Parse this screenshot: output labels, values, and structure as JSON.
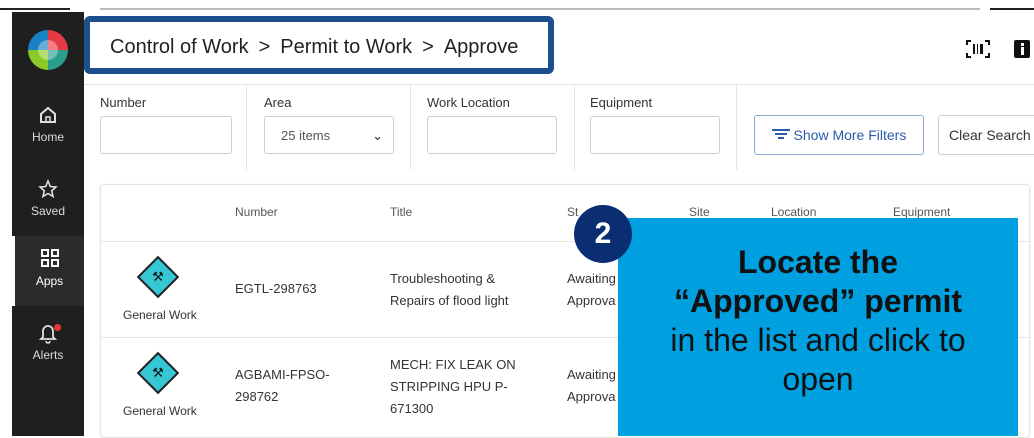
{
  "breadcrumb": {
    "part1": "Control of Work",
    "part2": "Permit to Work",
    "part3": "Approve",
    "separator": ">"
  },
  "header_icons": [
    "barcode-scan-icon",
    "info-icon"
  ],
  "sidebar": {
    "items": [
      {
        "label": "Home",
        "icon": "home-icon"
      },
      {
        "label": "Saved",
        "icon": "star-icon"
      },
      {
        "label": "Apps",
        "icon": "apps-grid-icon"
      },
      {
        "label": "Alerts",
        "icon": "bell-icon"
      }
    ]
  },
  "filters": {
    "number_label": "Number",
    "area_label": "Area",
    "area_value": "25 items",
    "work_location_label": "Work Location",
    "equipment_label": "Equipment",
    "show_more_label": "Show More Filters",
    "clear_search_label": "Clear Search"
  },
  "table": {
    "columns": [
      "Number",
      "Title",
      "St",
      "Site",
      "Location",
      "Equipment"
    ],
    "rows": [
      {
        "type": "General Work",
        "number": "EGTL-298763",
        "title_l1": "Troubleshooting &",
        "title_l2": "Repairs of flood light",
        "title_l3": "",
        "status_l1": "Awaiting",
        "status_l2": "Approva"
      },
      {
        "type": "General Work",
        "number_l1": "AGBAMI-FPSO-",
        "number_l2": "298762",
        "title_l1": "MECH: FIX LEAK ON",
        "title_l2": "STRIPPING HPU P-",
        "title_l3": "671300",
        "status_l1": "Awaiting",
        "status_l2": "Approva"
      }
    ]
  },
  "callout": {
    "step": "2",
    "line1": "Locate the",
    "line2": "“Approved” permit",
    "line3": "in the list and click to",
    "line4": "open",
    "color": "#009fdf"
  }
}
